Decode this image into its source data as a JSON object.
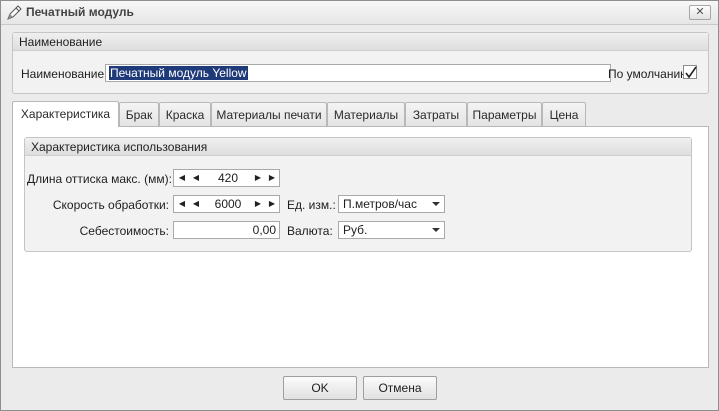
{
  "window": {
    "title": "Печатный модуль",
    "close": "✕"
  },
  "name_group": {
    "header": "Наименование",
    "name_label": "Наименование:",
    "name_value": "Печатный модуль Yellow",
    "default_label": "По умолчанию",
    "default_checked": true
  },
  "tabs": [
    {
      "label": "Характеристика",
      "active": true
    },
    {
      "label": "Брак"
    },
    {
      "label": "Краска"
    },
    {
      "label": "Материалы печати"
    },
    {
      "label": "Материалы"
    },
    {
      "label": "Затраты"
    },
    {
      "label": "Параметры"
    },
    {
      "label": "Цена"
    }
  ],
  "usage": {
    "header": "Характеристика использования",
    "max_length_label": "Длина оттиска макс. (мм):",
    "max_length_value": "420",
    "speed_label": "Скорость обработки:",
    "speed_value": "6000",
    "unit_label": "Ед. изм.:",
    "unit_value": "П.метров/час",
    "cost_label": "Себестоимость:",
    "cost_value": "0,00",
    "currency_label": "Валюта:",
    "currency_value": "Руб."
  },
  "buttons": {
    "ok": "OK",
    "cancel": "Отмена"
  }
}
